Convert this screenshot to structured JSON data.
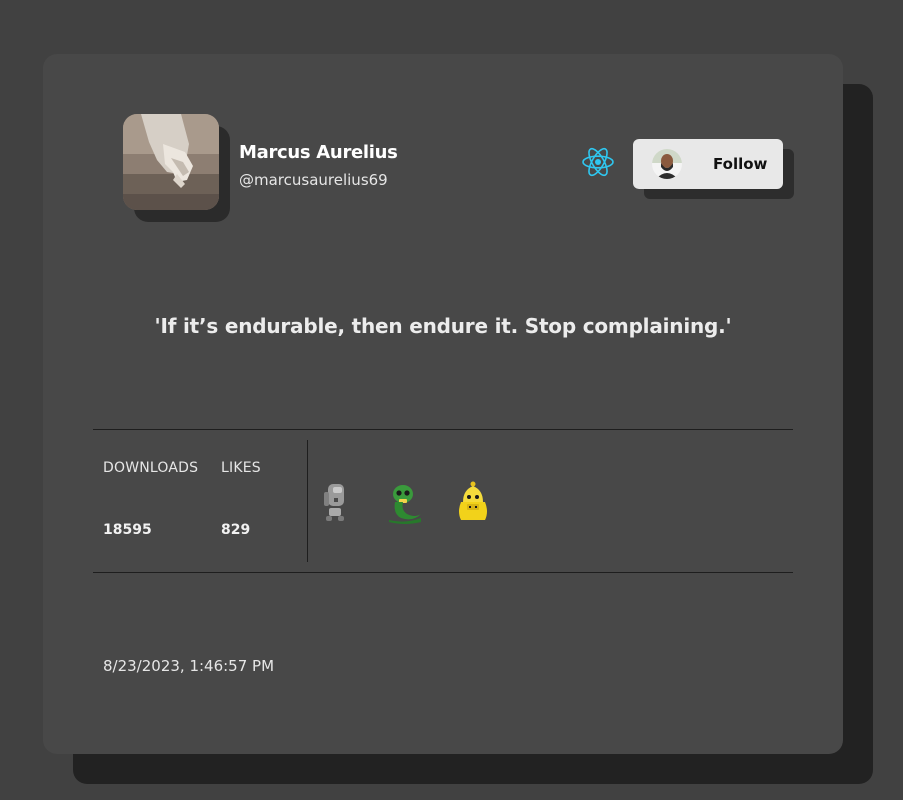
{
  "user": {
    "name": "Marcus Aurelius",
    "handle": "@marcusaurelius69"
  },
  "tech_icon": "react-icon",
  "follow_button": {
    "label": "Follow",
    "avatar_icon": "follower-avatar"
  },
  "quote": "'If it’s endurable, then endure it. Stop complaining.'",
  "stats": {
    "downloads_label": "DOWNLOADS",
    "likes_label": "LIKES",
    "downloads_value": "18595",
    "likes_value": "829"
  },
  "stickers": [
    "gray-robot-icon",
    "green-snake-icon",
    "yellow-creature-icon"
  ],
  "timestamp": "8/23/2023, 1:46:57 PM",
  "colors": {
    "background": "#414141",
    "card": "#484848",
    "card_shadow": "#222222",
    "accent_react": "#2fc7f0",
    "follow_button_bg": "#e8e8e8"
  }
}
